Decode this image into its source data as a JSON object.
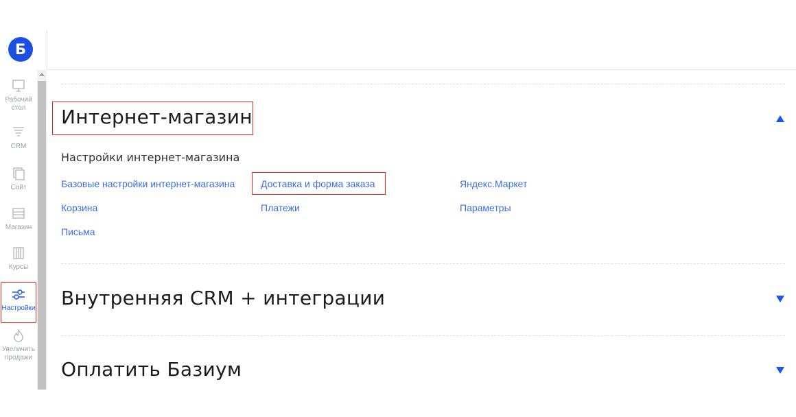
{
  "logo": {
    "letter": "Б"
  },
  "sidebar": {
    "items": [
      {
        "label_line1": "Рабочий",
        "label_line2": "стол",
        "icon": "monitor-icon",
        "active": false
      },
      {
        "label_line1": "CRM",
        "label_line2": "",
        "icon": "funnel-icon",
        "active": false
      },
      {
        "label_line1": "Сайт",
        "label_line2": "",
        "icon": "pages-icon",
        "active": false
      },
      {
        "label_line1": "Магазин",
        "label_line2": "",
        "icon": "shop-icon",
        "active": false
      },
      {
        "label_line1": "Курсы",
        "label_line2": "",
        "icon": "courses-icon",
        "active": false
      },
      {
        "label_line1": "Настройки",
        "label_line2": "",
        "icon": "sliders-icon",
        "active": true
      },
      {
        "label_line1": "Увеличить",
        "label_line2": "продажи",
        "icon": "flame-icon",
        "active": false
      }
    ]
  },
  "sections": {
    "shop": {
      "title": "Интернет-магазин",
      "expanded": true,
      "subheading": "Настройки интернет-магазина",
      "links": {
        "basic": "Базовые настройки интернет-магазина",
        "delivery": "Доставка и форма заказа",
        "yandex": "Яндекс.Маркет",
        "cart": "Корзина",
        "payments": "Платежи",
        "params": "Параметры",
        "letters": "Письма"
      }
    },
    "crm": {
      "title": "Внутренняя CRM + интеграции",
      "expanded": false
    },
    "pay": {
      "title": "Оплатить Базиум",
      "expanded": false
    }
  },
  "colors": {
    "accent": "#1a56f0",
    "link": "#3b6de3",
    "highlight": "#e0251b",
    "logo": "#1a4fe0"
  }
}
